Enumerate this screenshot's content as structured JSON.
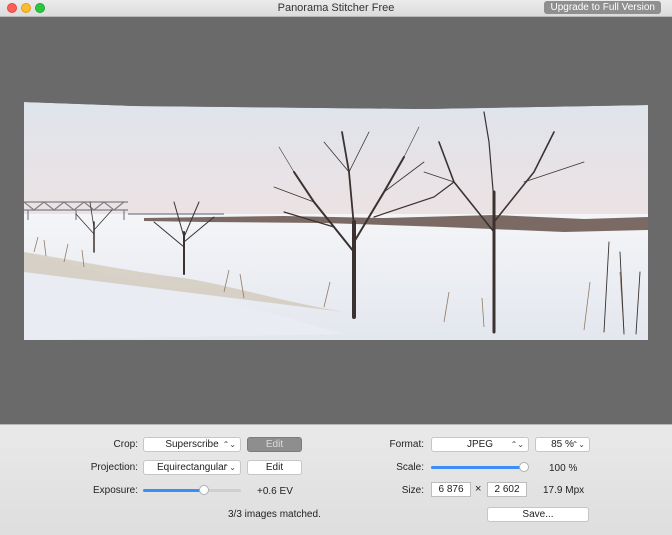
{
  "window": {
    "title": "Panorama Stitcher Free",
    "upgrade_label": "Upgrade to Full Version"
  },
  "controls": {
    "crop": {
      "label": "Crop:",
      "value": "Superscribe",
      "edit_label": "Edit",
      "edit_enabled": false
    },
    "projection": {
      "label": "Projection:",
      "value": "Equirectangular",
      "edit_label": "Edit",
      "edit_enabled": true
    },
    "exposure": {
      "label": "Exposure:",
      "value_text": "+0.6 EV",
      "slider_fraction": 0.64
    },
    "format": {
      "label": "Format:",
      "value": "JPEG",
      "quality": "85 %"
    },
    "scale": {
      "label": "Scale:",
      "value_text": "100 %",
      "slider_fraction": 1.0
    },
    "size": {
      "label": "Size:",
      "width": "6 876",
      "times": "×",
      "height": "2 602",
      "megapixels": "17.9 Mpx"
    },
    "status": "3/3 images matched.",
    "save_label": "Save..."
  },
  "icons": {
    "popup": "chevron-updown-icon"
  },
  "colors": {
    "accent": "#3b8ef5",
    "canvas": "#6a6a6a"
  }
}
